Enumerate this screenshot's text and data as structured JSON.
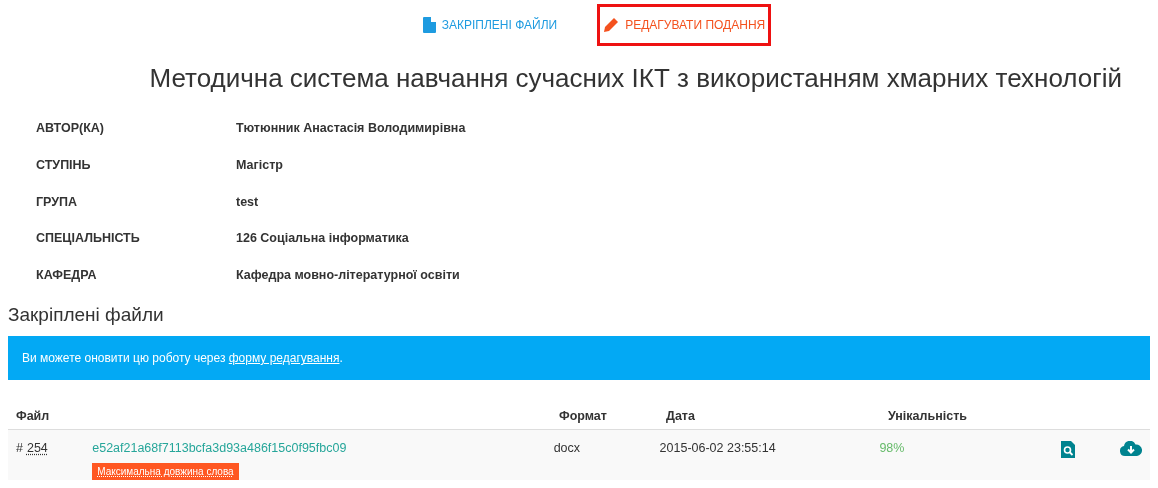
{
  "nav": [
    {
      "kind": "file",
      "label": "ЗАКРІПЛЕНІ ФАЙЛИ",
      "highlighted": false
    },
    {
      "kind": "edit",
      "label": "РЕДАГУВАТИ ПОДАННЯ",
      "highlighted": true
    }
  ],
  "title": "Методична система навчання сучасних ІКТ з використанням хмарних технологій",
  "details": [
    {
      "label": "АВТОР(КА)",
      "value": "Тютюнник Анастасія Володимирівна"
    },
    {
      "label": "СТУПІНЬ",
      "value": "Магістр"
    },
    {
      "label": "ГРУПА",
      "value": "test"
    },
    {
      "label": "СПЕЦІАЛЬНІСТЬ",
      "value": "126 Соціальна інформатика"
    },
    {
      "label": "КАФЕДРА",
      "value": "Кафедра мовно-літературної освіти"
    }
  ],
  "section_heading": "Закріплені файли",
  "alert": {
    "text": "Ви можете оновити цю роботу через",
    "link": "форму редагування",
    "end": "."
  },
  "table": {
    "columns": [
      "Файл",
      "Формат",
      "Дата",
      "Унікальність"
    ],
    "rows": [
      {
        "hash_mark": "#",
        "number": "254",
        "file": "e52af21a68f7113bcfa3d93a486f15c0f95fbc09",
        "badge": "Максимальна довжина слова",
        "format": "docx",
        "date": "2015-06-02 23:55:14",
        "uniqueness": "98%"
      }
    ]
  }
}
